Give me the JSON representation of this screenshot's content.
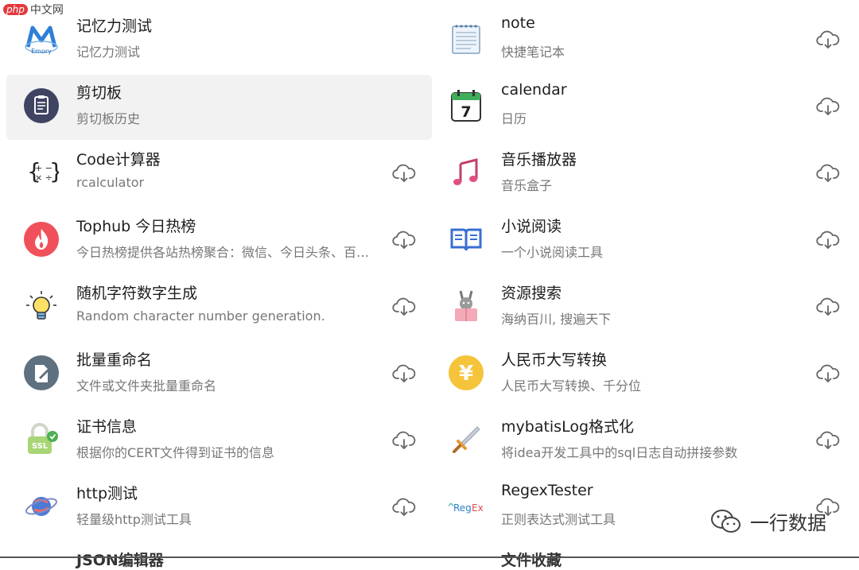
{
  "left": [
    {
      "title": "记忆力测试",
      "desc": "记忆力测试",
      "icon": "memory-icon",
      "download": false,
      "selected": false
    },
    {
      "title": "剪切板",
      "desc": "剪切板历史",
      "icon": "clipboard-icon",
      "download": false,
      "selected": true
    },
    {
      "title": "Code计算器",
      "desc": "rcalculator",
      "icon": "calculator-icon",
      "download": true,
      "selected": false
    },
    {
      "title": "Tophub 今日热榜",
      "desc": "今日热榜提供各站热榜聚合：微信、今日头条、百…",
      "icon": "flame-icon",
      "download": true,
      "selected": false
    },
    {
      "title": "随机字符数字生成",
      "desc": "Random character number generation.",
      "icon": "lightbulb-icon",
      "download": true,
      "selected": false
    },
    {
      "title": "批量重命名",
      "desc": "文件或文件夹批量重命名",
      "icon": "rename-icon",
      "download": true,
      "selected": false
    },
    {
      "title": "证书信息",
      "desc": "根据你的CERT文件得到证书的信息",
      "icon": "ssl-lock-icon",
      "download": true,
      "selected": false
    },
    {
      "title": "http测试",
      "desc": "轻量级http测试工具",
      "icon": "planet-icon",
      "download": true,
      "selected": false
    }
  ],
  "right": [
    {
      "title": "note",
      "desc": "快捷笔记本",
      "icon": "notepad-icon",
      "download": true
    },
    {
      "title": "calendar",
      "desc": "日历",
      "icon": "calendar-icon",
      "download": true
    },
    {
      "title": "音乐播放器",
      "desc": "音乐盒子",
      "icon": "music-note-icon",
      "download": true
    },
    {
      "title": "小说阅读",
      "desc": "一个小说阅读工具",
      "icon": "book-icon",
      "download": true
    },
    {
      "title": "资源搜索",
      "desc": "海纳百川, 搜遍天下",
      "icon": "reader-rabbit-icon",
      "download": true
    },
    {
      "title": "人民币大写转换",
      "desc": "人民币大写转换、千分位",
      "icon": "yen-icon",
      "download": true
    },
    {
      "title": "mybatisLog格式化",
      "desc": "将idea开发工具中的sql日志自动拼接参数",
      "icon": "sword-icon",
      "download": true
    },
    {
      "title": "RegexTester",
      "desc": "正则表达式测试工具",
      "icon": "regex-icon",
      "download": true
    }
  ],
  "partial_left": "JSON编辑器",
  "partial_right": "文件收藏",
  "logo": {
    "badge": "php",
    "text": "中文网"
  },
  "watermark": "一行数据",
  "colors": {
    "selected_bg": "#f2f2f3",
    "title": "#1d1d1f",
    "desc": "#777777",
    "cloud": "#666666"
  }
}
